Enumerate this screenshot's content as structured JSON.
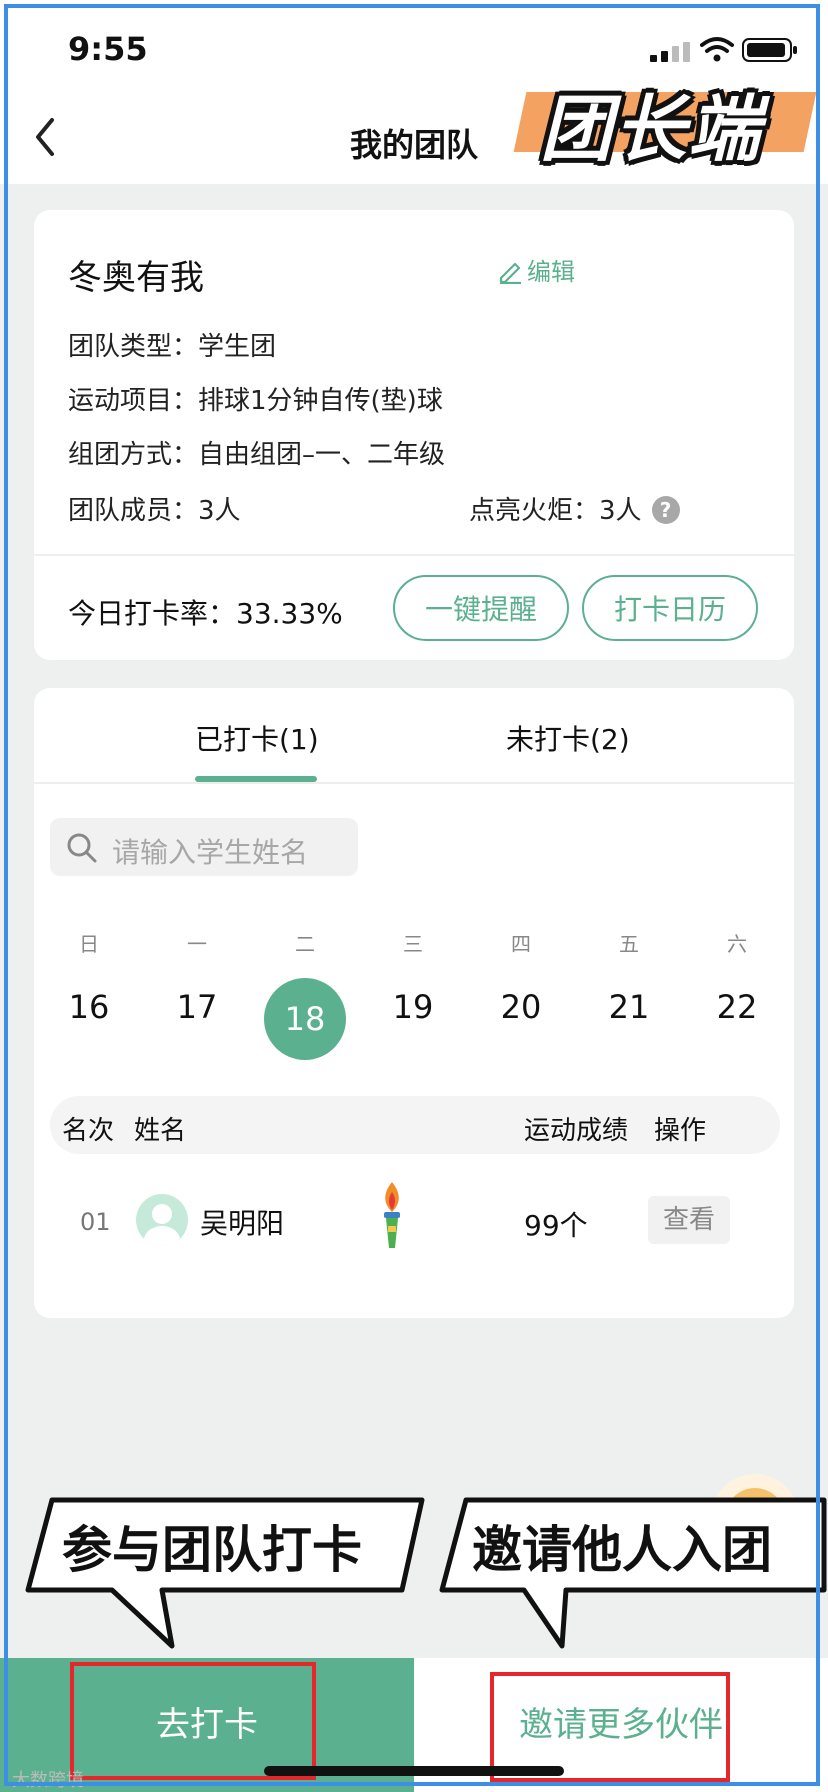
{
  "status_bar": {
    "time": "9:55"
  },
  "header": {
    "title": "我的团队",
    "sticker_text": "团长端"
  },
  "team": {
    "name": "冬奥有我",
    "edit_label": "编辑",
    "type": "团队类型：学生团",
    "sport": "运动项目：排球1分钟自传(垫)球",
    "mode": "组团方式：自由组团–一、二年级",
    "members": "团队成员：3人",
    "torch": "点亮火炬：3人",
    "help_icon_text": "?",
    "rate": "今日打卡率：33.33%",
    "remind_button": "一键提醒",
    "calendar_button": "打卡日历"
  },
  "tabs": [
    {
      "label": "已打卡(1)",
      "active": true
    },
    {
      "label": "未打卡(2)",
      "active": false
    }
  ],
  "search": {
    "placeholder": "请输入学生姓名"
  },
  "week": {
    "weekdays": [
      "日",
      "一",
      "二",
      "三",
      "四",
      "五",
      "六"
    ],
    "dates": [
      "16",
      "17",
      "18",
      "19",
      "20",
      "21",
      "22"
    ],
    "selected": "18"
  },
  "table": {
    "headers": {
      "rank": "名次",
      "name": "姓名",
      "score": "运动成绩",
      "action": "操作"
    },
    "rows": [
      {
        "rank": "01",
        "name": "吴明阳",
        "score": "99个",
        "action": "查看"
      }
    ]
  },
  "callouts": {
    "left": "参与团队打卡",
    "right": "邀请他人入团"
  },
  "bottom": {
    "go": "去打卡",
    "invite": "邀请更多伙伴"
  },
  "watermark": "大数跨境",
  "colors": {
    "accent": "#5bb090",
    "highlight": "#e5272b",
    "frame": "#3d8fe6"
  }
}
